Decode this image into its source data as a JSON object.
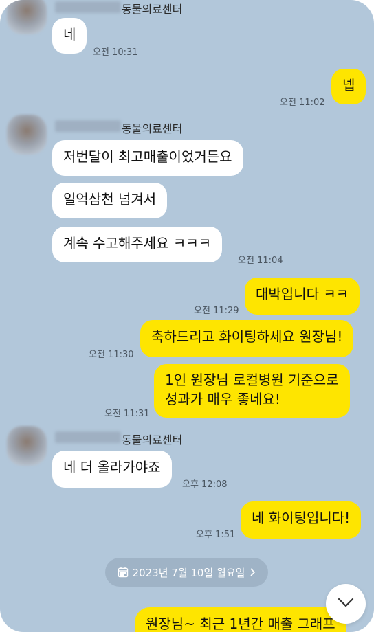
{
  "sender": {
    "name": "동물의료센터"
  },
  "messages": {
    "m1": {
      "text": "네",
      "time": "오전 10:31"
    },
    "m2": {
      "text": "넵",
      "time": "오전 11:02"
    },
    "m3": {
      "text": "저번달이 최고매출이었거든요"
    },
    "m4": {
      "text": "일억삼천 넘겨서"
    },
    "m5": {
      "text": "계속 수고해주세요 ㅋㅋㅋ",
      "time": "오전 11:04"
    },
    "m6": {
      "text": "대박입니다 ㅋㅋ",
      "time": "오전 11:29"
    },
    "m7": {
      "text": "축하드리고 화이팅하세요 원장님!",
      "time": "오전 11:30"
    },
    "m8": {
      "line1": "1인 원장님 로컬병원 기준으로",
      "line2": "성과가 매우 좋네요!",
      "time": "오전 11:31"
    },
    "m9": {
      "text": "네 더 올라가야죠",
      "time": "오후 12:08"
    },
    "m10": {
      "text": "네 화이팅입니다!",
      "time": "오후 1:51"
    },
    "m11": {
      "text": "원장님~ 최근 1년간 매출 그래프"
    }
  },
  "date_divider": {
    "label": "2023년 7월 10일 월요일"
  },
  "icons": {
    "calendar": "calendar-icon",
    "chevron": "chevron-right-icon",
    "scroll_down": "chevron-down-icon"
  },
  "colors": {
    "background": "#b2c7da",
    "outgoing_bubble": "#fee500",
    "incoming_bubble": "#ffffff"
  }
}
